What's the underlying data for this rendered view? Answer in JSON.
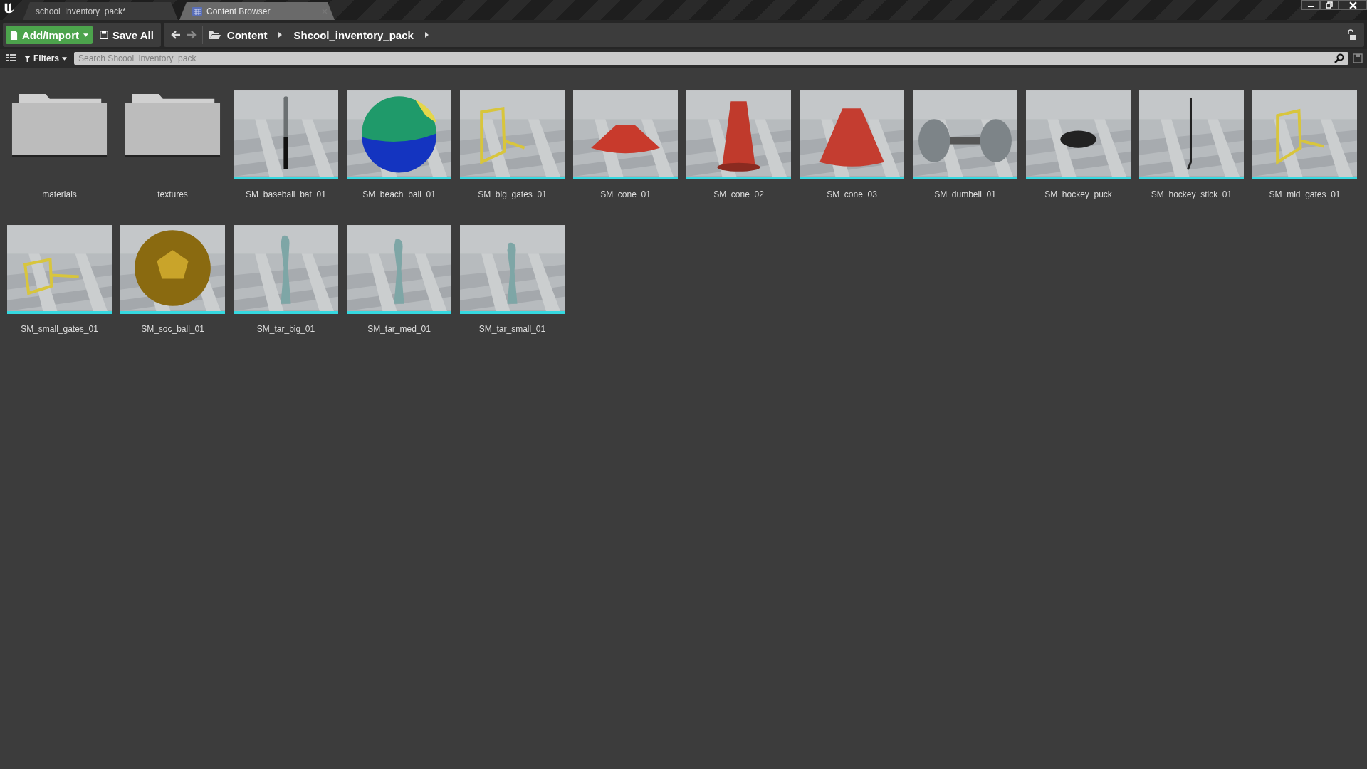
{
  "tabs": [
    {
      "label": "school_inventory_pack*",
      "selected": false,
      "kind": "level"
    },
    {
      "label": "Content Browser",
      "selected": true,
      "kind": "browser"
    }
  ],
  "toolbar": {
    "add_import": "Add/Import",
    "save_all": "Save All",
    "breadcrumbs": [
      "Content",
      "Shcool_inventory_pack"
    ]
  },
  "filter_bar": {
    "filters": "Filters",
    "search": {
      "placeholder": "Search Shcool_inventory_pack"
    }
  },
  "assets": [
    {
      "name": "materials",
      "kind": "folder"
    },
    {
      "name": "textures",
      "kind": "folder"
    },
    {
      "name": "SM_baseball_bat_01",
      "kind": "picture"
    },
    {
      "name": "SM_beach_ball_01",
      "kind": "picture"
    },
    {
      "name": "SM_big_gates_01",
      "kind": "picture"
    },
    {
      "name": "SM_cone_01",
      "kind": "picture"
    },
    {
      "name": "SM_cone_02",
      "kind": "picture"
    },
    {
      "name": "SM_cone_03",
      "kind": "picture"
    },
    {
      "name": "SM_dumbell_01",
      "kind": "picture"
    },
    {
      "name": "SM_hockey_puck",
      "kind": "picture"
    },
    {
      "name": "SM_hockey_stick_01",
      "kind": "picture"
    },
    {
      "name": "SM_mid_gates_01",
      "kind": "picture"
    },
    {
      "name": "SM_small_gates_01",
      "kind": "picture"
    },
    {
      "name": "SM_soc_ball_01",
      "kind": "picture"
    },
    {
      "name": "SM_tar_big_01",
      "kind": "picture"
    },
    {
      "name": "SM_tar_med_01",
      "kind": "picture"
    },
    {
      "name": "SM_tar_small_01",
      "kind": "picture"
    }
  ]
}
